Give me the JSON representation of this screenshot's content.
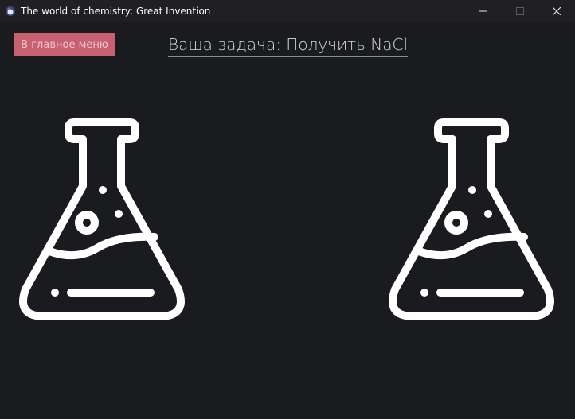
{
  "window": {
    "title": "The world of chemistry: Great Invention",
    "controls": [
      "minimize",
      "maximize",
      "close"
    ]
  },
  "toolbar": {
    "main_menu_label": "В главное меню"
  },
  "task": {
    "text": "Ваша задача: Получить NaCl"
  },
  "icons": {
    "app": "app-icon",
    "flask_left": "flask-icon",
    "flask_right": "flask-icon"
  },
  "colors": {
    "background": "#1a1b1f",
    "titlebar": "#202024",
    "button": "#c76171",
    "button_text": "#f2c4cb",
    "flask": "#ffffff"
  }
}
